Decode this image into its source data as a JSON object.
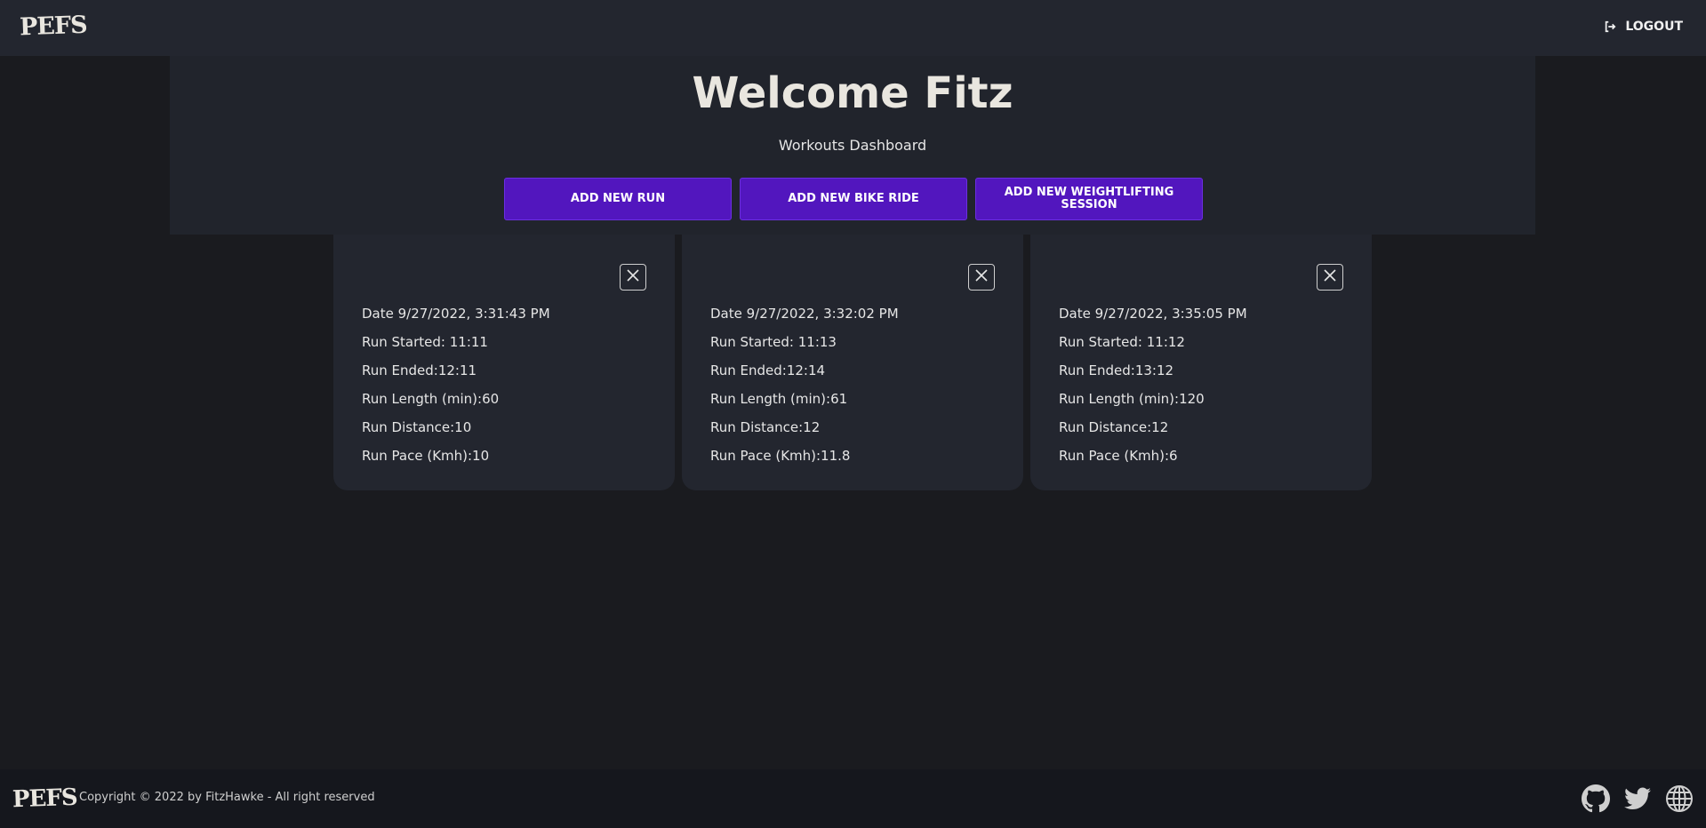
{
  "navbar": {
    "logo": "PEFS",
    "logout_icon": "logout-icon",
    "logout_label": "LOGOUT"
  },
  "hero": {
    "title": "Welcome Fitz",
    "subtitle": "Workouts Dashboard",
    "buttons": [
      {
        "label": "ADD NEW RUN"
      },
      {
        "label": "ADD NEW BIKE RIDE"
      },
      {
        "label": "ADD NEW WEIGHTLIFTING SESSION"
      }
    ]
  },
  "runs": [
    {
      "date": "Date 9/27/2022, 3:31:43 PM",
      "started": "Run Started: 11:11",
      "ended": "Run Ended:12:11",
      "length": "Run Length (min):60",
      "distance": "Run Distance:10",
      "pace": "Run Pace (Kmh):10"
    },
    {
      "date": "Date 9/27/2022, 3:32:02 PM",
      "started": "Run Started: 11:13",
      "ended": "Run Ended:12:14",
      "length": "Run Length (min):61",
      "distance": "Run Distance:12",
      "pace": "Run Pace (Kmh):11.8"
    },
    {
      "date": "Date 9/27/2022, 3:35:05 PM",
      "started": "Run Started: 11:12",
      "ended": "Run Ended:13:12",
      "length": "Run Length (min):120",
      "distance": "Run Distance:12",
      "pace": "Run Pace (Kmh):6"
    }
  ],
  "footer": {
    "logo": "PEFS",
    "copyright": "Copyright © 2022 by FitzHawke - All right reserved",
    "social_icons": [
      "github-icon",
      "twitter-icon",
      "globe-icon"
    ]
  },
  "colors": {
    "background": "#1a1b1f",
    "navbar": "#23262f",
    "card": "#23262f",
    "accent_button": "#5216be",
    "footer": "#15171d"
  }
}
